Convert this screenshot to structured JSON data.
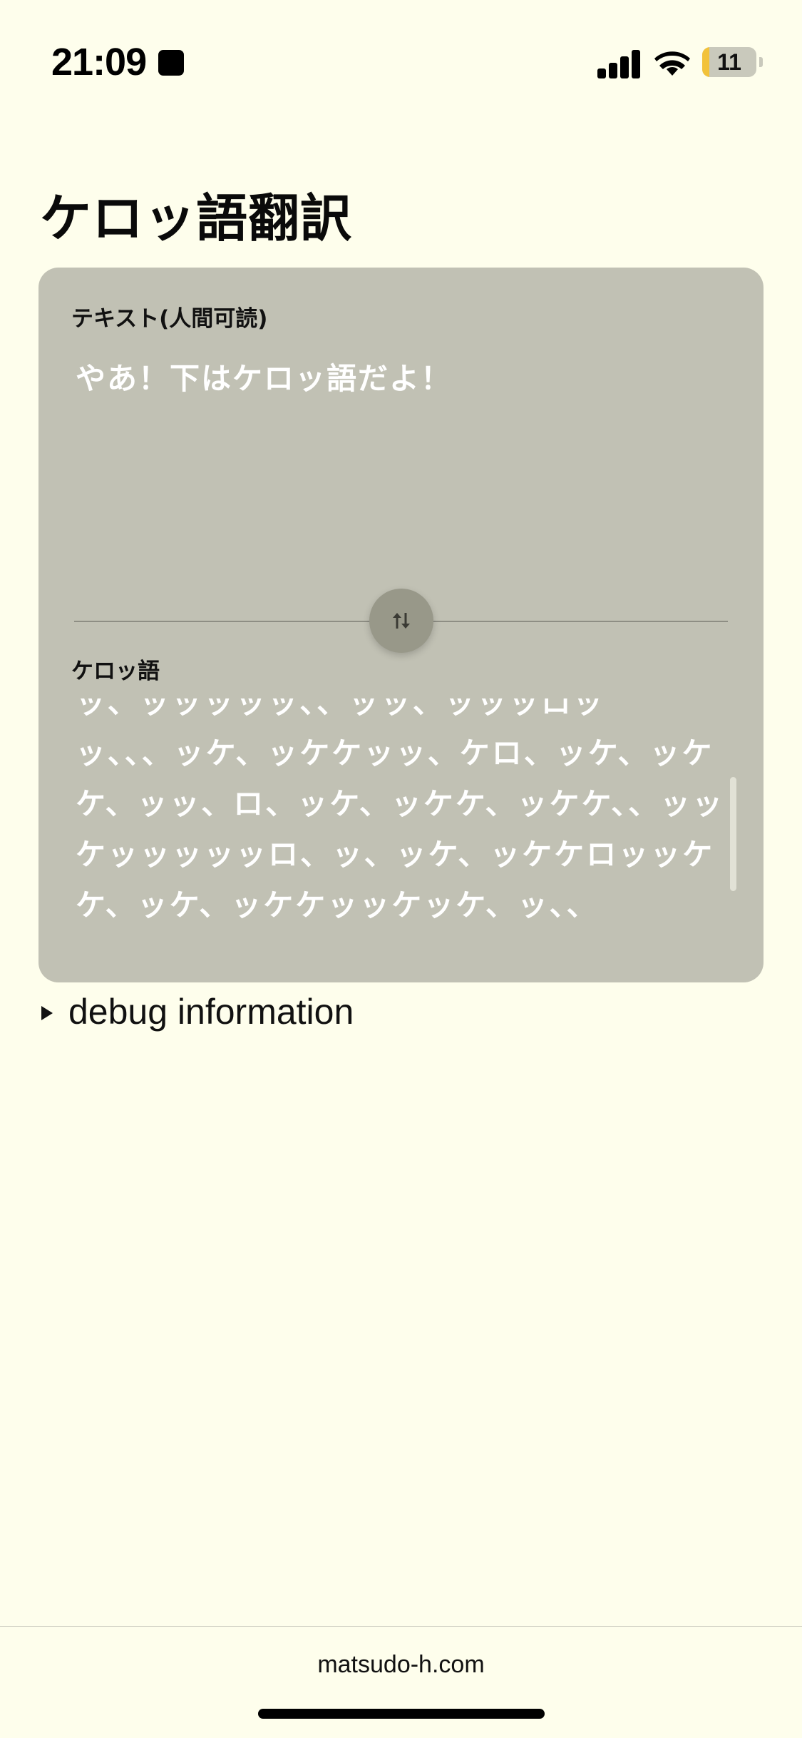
{
  "status_bar": {
    "time": "21:09",
    "battery_level": "11",
    "battery_color": "#f2c23a",
    "icons": [
      "stop-icon",
      "signal-icon",
      "wifi-icon",
      "battery-icon"
    ]
  },
  "page": {
    "title": "ケロッ語翻訳"
  },
  "translator": {
    "human_label": "テキスト(人間可読)",
    "human_text": "やあ！下はケロッ語だよ！",
    "kero_label": "ケロッ語",
    "kero_text": "ッ、ッッッッッ、、ッッ、ッッッロッ\nッ、、、ッケ、ッケケッッ、ケロ、ッケ、ッケケ、ッッ、ロ、ッケ、ッケケ、ッケケ、、ッッケッッッッッロ、ッ、ッケ、ッケケロッッケケ、ッケ、ッケケッッケッケ、ッ、、",
    "swap_icon": "swap-vertical-icon",
    "card_color": "#c1c1b4"
  },
  "debug": {
    "summary": "debug information"
  },
  "footer": {
    "domain": "matsudo-h.com"
  },
  "colors": {
    "background": "#fefeec",
    "text_light": "#ffffff"
  }
}
